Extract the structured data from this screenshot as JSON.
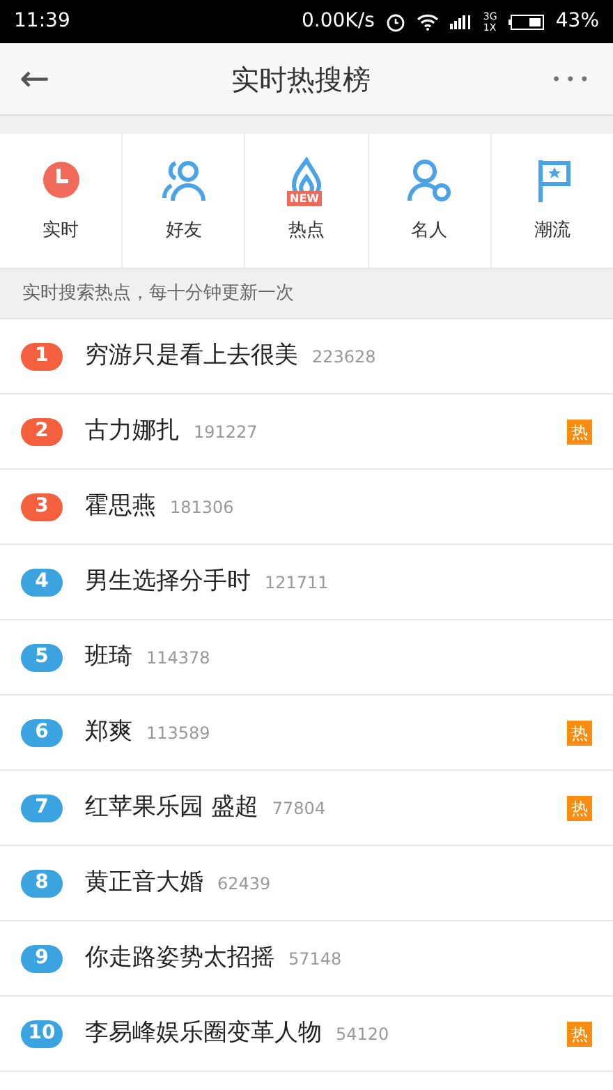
{
  "status_bar": {
    "time": "11:39",
    "speed": "0.00K/s",
    "network": "3G 1X",
    "battery": "43%"
  },
  "header": {
    "back": "←",
    "title": "实时热搜榜",
    "more": "•••"
  },
  "categories": [
    {
      "kind": "clock",
      "label": "实时",
      "selected": true
    },
    {
      "kind": "friends",
      "label": "好友",
      "selected": false
    },
    {
      "kind": "flame",
      "label": "热点",
      "selected": false,
      "badge": "NEW"
    },
    {
      "kind": "person",
      "label": "名人",
      "selected": false
    },
    {
      "kind": "flag",
      "label": "潮流",
      "selected": false
    }
  ],
  "hint": "实时搜索热点，每十分钟更新一次",
  "rows": [
    {
      "rank": "1",
      "color": "#f4603d",
      "title": "穷游只是看上去很美",
      "count": "223628"
    },
    {
      "rank": "2",
      "color": "#f4603d",
      "title": "古力娜扎",
      "count": "191227",
      "tag": "热"
    },
    {
      "rank": "3",
      "color": "#f4603d",
      "title": "霍思燕",
      "count": "181306"
    },
    {
      "rank": "4",
      "color": "#3aa3e0",
      "title": "男生选择分手时",
      "count": "121711"
    },
    {
      "rank": "5",
      "color": "#3aa3e0",
      "title": "班琦",
      "count": "114378"
    },
    {
      "rank": "6",
      "color": "#3aa3e0",
      "title": "郑爽",
      "count": "113589",
      "tag": "热"
    },
    {
      "rank": "7",
      "color": "#3aa3e0",
      "title": "红苹果乐园 盛超",
      "count": "77804",
      "tag": "热"
    },
    {
      "rank": "8",
      "color": "#3aa3e0",
      "title": "黄正音大婚",
      "count": "62439"
    },
    {
      "rank": "9",
      "color": "#3aa3e0",
      "title": "你走路姿势太招摇",
      "count": "57148"
    },
    {
      "rank": "10",
      "color": "#3aa3e0",
      "title": "李易峰娱乐圈变革人物",
      "count": "54120",
      "tag": "热"
    }
  ]
}
